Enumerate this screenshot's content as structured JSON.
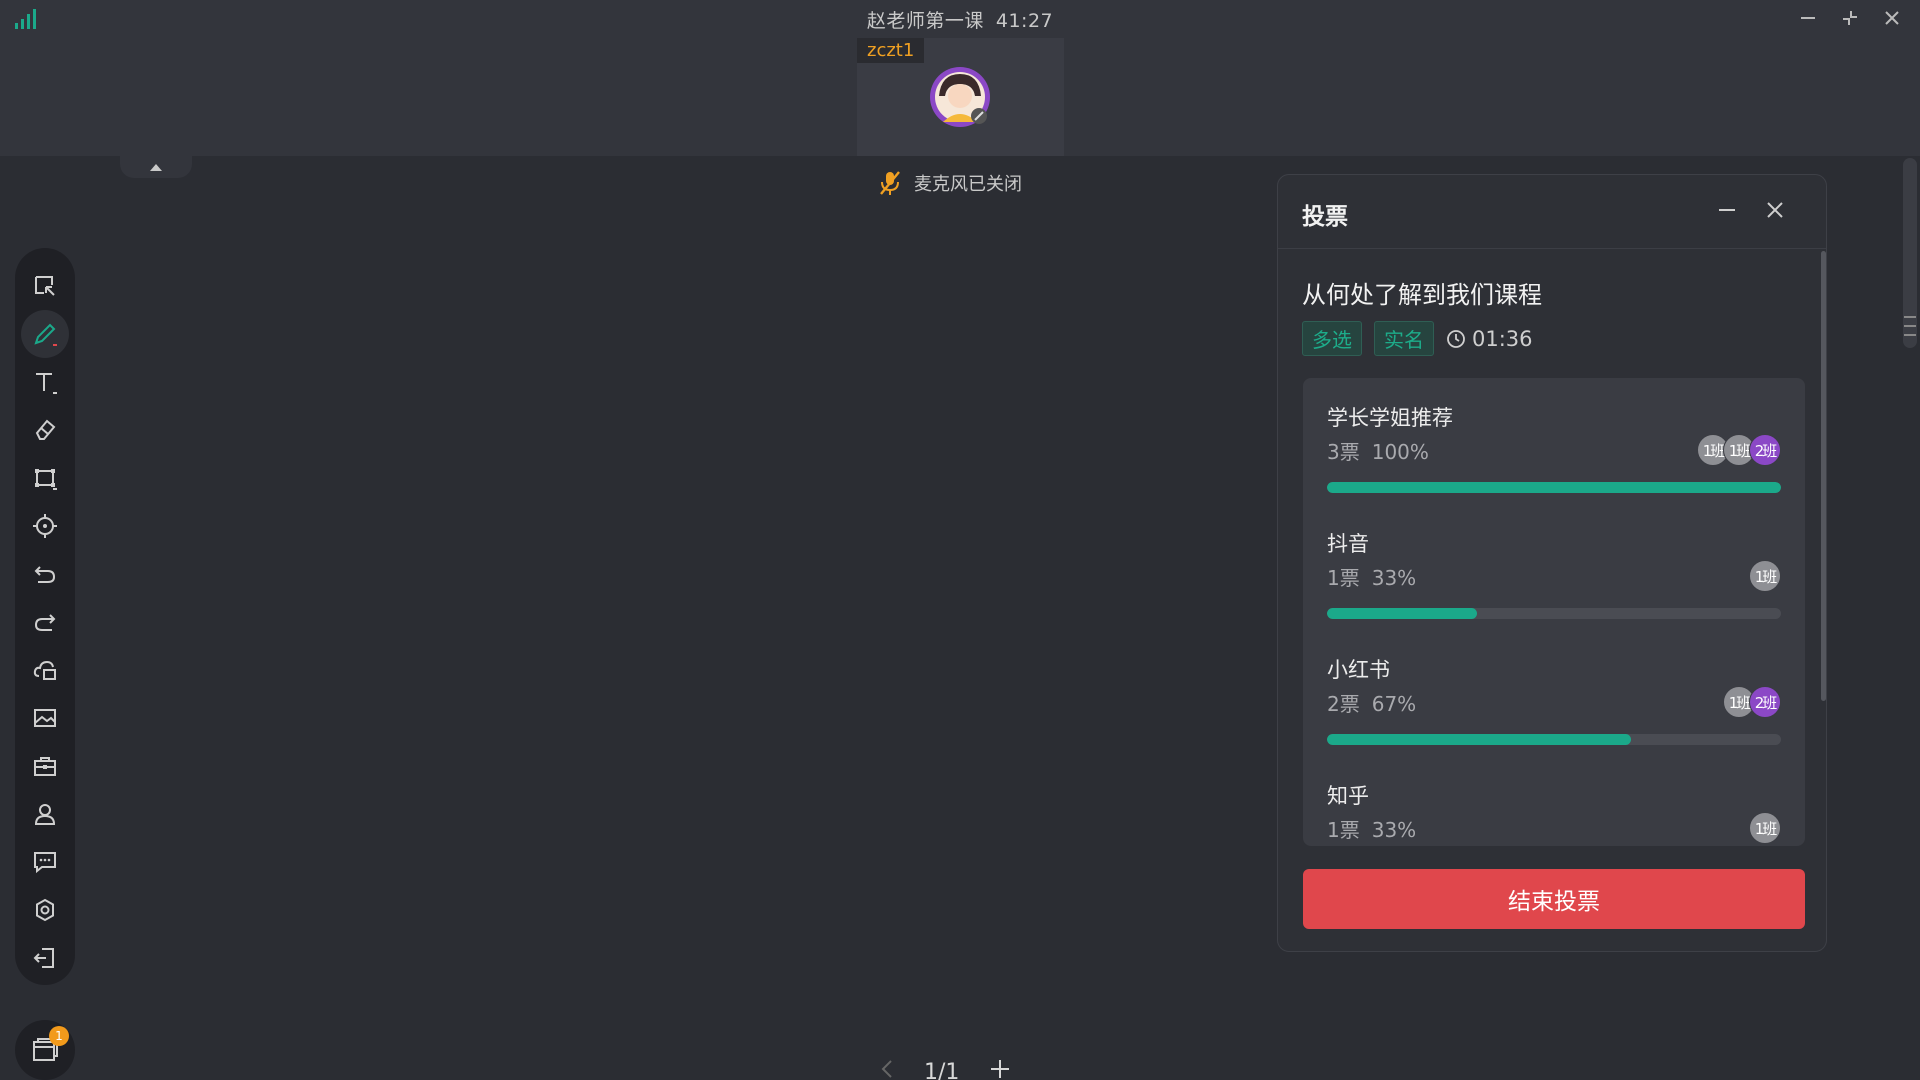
{
  "window": {
    "title": "赵老师第一课",
    "elapsed": "41:27"
  },
  "video": {
    "participant_name": "zczt1"
  },
  "mic_status": "麦克风已关闭",
  "toolbar": {
    "tools": [
      "select",
      "pen",
      "text",
      "eraser",
      "shape",
      "laser-pointer",
      "undo",
      "redo",
      "cloud-files",
      "image",
      "toolbox",
      "members",
      "chat",
      "settings",
      "exit"
    ]
  },
  "dock": {
    "badge_count": "1"
  },
  "pager": {
    "label": "1/1"
  },
  "poll": {
    "panel_title": "投票",
    "question": "从何处了解到我们课程",
    "tags": [
      "多选",
      "实名"
    ],
    "countdown": "01:36",
    "options": [
      {
        "label": "学长学姐推荐",
        "votes": "3票",
        "percent_label": "100%",
        "percent": 100,
        "voters": [
          {
            "text": "1班",
            "color": "#8e8f94"
          },
          {
            "text": "1班",
            "color": "#8e8f94"
          },
          {
            "text": "2班",
            "color": "#8b48c6"
          }
        ]
      },
      {
        "label": "抖音",
        "votes": "1票",
        "percent_label": "33%",
        "percent": 33,
        "voters": [
          {
            "text": "1班",
            "color": "#8e8f94"
          }
        ]
      },
      {
        "label": "小红书",
        "votes": "2票",
        "percent_label": "67%",
        "percent": 67,
        "voters": [
          {
            "text": "1班",
            "color": "#8e8f94"
          },
          {
            "text": "2班",
            "color": "#8b48c6"
          }
        ]
      },
      {
        "label": "知乎",
        "votes": "1票",
        "percent_label": "33%",
        "percent": 33,
        "voters": [
          {
            "text": "1班",
            "color": "#8e8f94"
          }
        ]
      }
    ],
    "end_button": "结束投票"
  },
  "colors": {
    "accent": "#1ba98a",
    "danger": "#e0474c",
    "name_tag": "#f0a022"
  }
}
